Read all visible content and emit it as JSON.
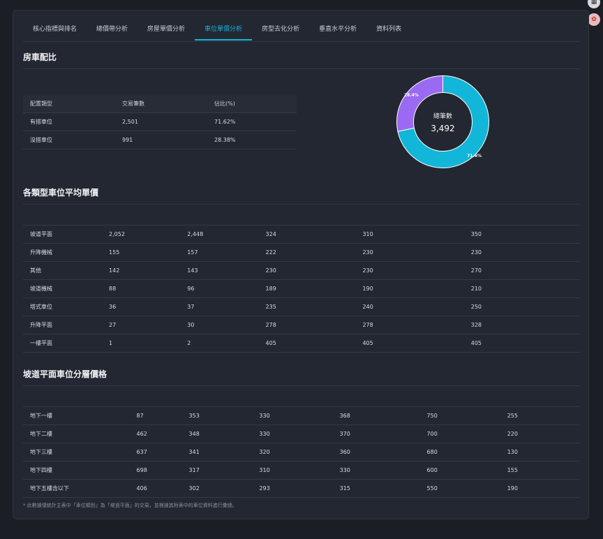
{
  "tabs": [
    {
      "label": "核心指標與排名"
    },
    {
      "label": "總價帶分析"
    },
    {
      "label": "房屋單價分析"
    },
    {
      "label": "車位單價分析"
    },
    {
      "label": "房型去化分析"
    },
    {
      "label": "垂直水平分析"
    },
    {
      "label": "資料列表"
    }
  ],
  "active_tab": 3,
  "section1": {
    "title": "房車配比",
    "headers": [
      "配置類型",
      "交易筆數",
      "佔比(%)"
    ],
    "rows": [
      [
        "有搭車位",
        "2,501",
        "71.62%"
      ],
      [
        "沒搭車位",
        "991",
        "28.38%"
      ]
    ],
    "donut": {
      "center_label": "總筆數",
      "center_value": "3,492",
      "colors": {
        "with": "#12b6d8",
        "without": "#9b6af2"
      },
      "slices": [
        {
          "label": "71.6%",
          "value": 71.62
        },
        {
          "label": "28.4%",
          "value": 28.38
        }
      ]
    }
  },
  "section2": {
    "title": "各類型車位平均單價",
    "rows": [
      [
        "坡道平面",
        "2,052",
        "2,448",
        "324",
        "310",
        "350"
      ],
      [
        "升降機械",
        "155",
        "157",
        "222",
        "230",
        "230"
      ],
      [
        "其他",
        "142",
        "143",
        "230",
        "230",
        "270"
      ],
      [
        "坡道機械",
        "88",
        "96",
        "189",
        "190",
        "210"
      ],
      [
        "塔式車位",
        "36",
        "37",
        "235",
        "240",
        "250"
      ],
      [
        "升降平面",
        "27",
        "30",
        "278",
        "278",
        "328"
      ],
      [
        "一樓平面",
        "1",
        "2",
        "405",
        "405",
        "405"
      ]
    ]
  },
  "section3": {
    "title": "坡道平面車位分層價格",
    "rows": [
      [
        "地下一樓",
        "87",
        "353",
        "330",
        "368",
        "750",
        "255"
      ],
      [
        "地下二樓",
        "462",
        "348",
        "330",
        "370",
        "700",
        "220"
      ],
      [
        "地下三樓",
        "637",
        "341",
        "320",
        "360",
        "680",
        "130"
      ],
      [
        "地下四樓",
        "698",
        "317",
        "310",
        "330",
        "600",
        "155"
      ],
      [
        "地下五樓含以下",
        "406",
        "302",
        "293",
        "315",
        "550",
        "190"
      ]
    ]
  },
  "footnote": "* 此數據僅統計主表中「車位類別」為「坡道平面」的交易，並根據其附表中的車位資料進行彙總。"
}
